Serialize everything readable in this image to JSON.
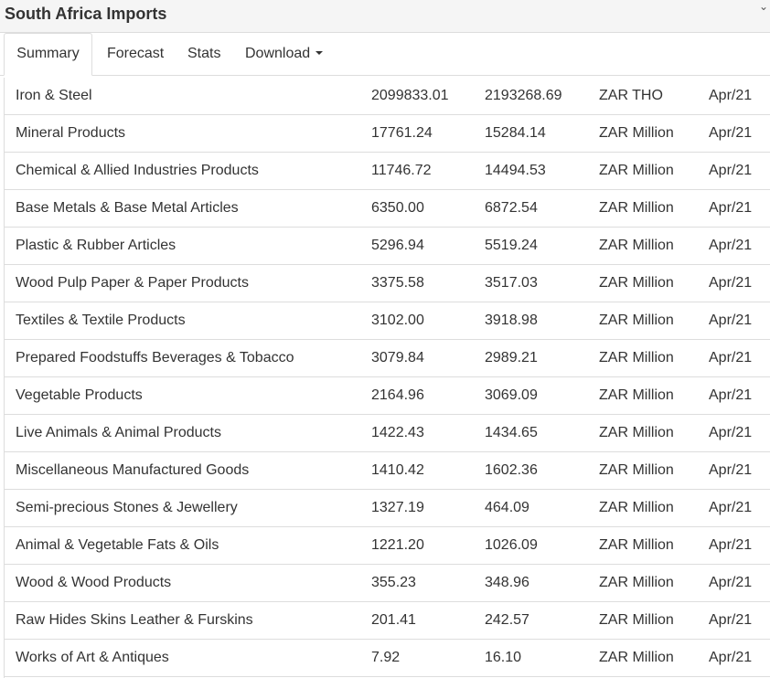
{
  "header": {
    "title": "South Africa Imports"
  },
  "tabs": [
    {
      "label": "Summary",
      "active": true
    },
    {
      "label": "Forecast",
      "active": false
    },
    {
      "label": "Stats",
      "active": false
    },
    {
      "label": "Download",
      "active": false,
      "dropdown": true
    }
  ],
  "table": {
    "rows": [
      {
        "name": "Iron & Steel",
        "last": "2099833.01",
        "previous": "2193268.69",
        "unit": "ZAR THO",
        "date": "Apr/21"
      },
      {
        "name": "Mineral Products",
        "last": "17761.24",
        "previous": "15284.14",
        "unit": "ZAR Million",
        "date": "Apr/21"
      },
      {
        "name": "Chemical & Allied Industries Products",
        "last": "11746.72",
        "previous": "14494.53",
        "unit": "ZAR Million",
        "date": "Apr/21"
      },
      {
        "name": "Base Metals & Base Metal Articles",
        "last": "6350.00",
        "previous": "6872.54",
        "unit": "ZAR Million",
        "date": "Apr/21"
      },
      {
        "name": "Plastic & Rubber Articles",
        "last": "5296.94",
        "previous": "5519.24",
        "unit": "ZAR Million",
        "date": "Apr/21"
      },
      {
        "name": "Wood Pulp Paper & Paper Products",
        "last": "3375.58",
        "previous": "3517.03",
        "unit": "ZAR Million",
        "date": "Apr/21"
      },
      {
        "name": "Textiles & Textile Products",
        "last": "3102.00",
        "previous": "3918.98",
        "unit": "ZAR Million",
        "date": "Apr/21"
      },
      {
        "name": "Prepared Foodstuffs Beverages & Tobacco",
        "last": "3079.84",
        "previous": "2989.21",
        "unit": "ZAR Million",
        "date": "Apr/21"
      },
      {
        "name": "Vegetable Products",
        "last": "2164.96",
        "previous": "3069.09",
        "unit": "ZAR Million",
        "date": "Apr/21"
      },
      {
        "name": "Live Animals & Animal Products",
        "last": "1422.43",
        "previous": "1434.65",
        "unit": "ZAR Million",
        "date": "Apr/21"
      },
      {
        "name": "Miscellaneous Manufactured Goods",
        "last": "1410.42",
        "previous": "1602.36",
        "unit": "ZAR Million",
        "date": "Apr/21"
      },
      {
        "name": "Semi-precious Stones & Jewellery",
        "last": "1327.19",
        "previous": "464.09",
        "unit": "ZAR Million",
        "date": "Apr/21"
      },
      {
        "name": "Animal & Vegetable Fats & Oils",
        "last": "1221.20",
        "previous": "1026.09",
        "unit": "ZAR Million",
        "date": "Apr/21"
      },
      {
        "name": "Wood & Wood Products",
        "last": "355.23",
        "previous": "348.96",
        "unit": "ZAR Million",
        "date": "Apr/21"
      },
      {
        "name": "Raw Hides Skins Leather & Furskins",
        "last": "201.41",
        "previous": "242.57",
        "unit": "ZAR Million",
        "date": "Apr/21"
      },
      {
        "name": "Works of Art & Antiques",
        "last": "7.92",
        "previous": "16.10",
        "unit": "ZAR Million",
        "date": "Apr/21"
      }
    ]
  },
  "colors": {
    "text": "#333333",
    "border": "#dddddd",
    "title_bar_bg": "#f5f5f5"
  }
}
